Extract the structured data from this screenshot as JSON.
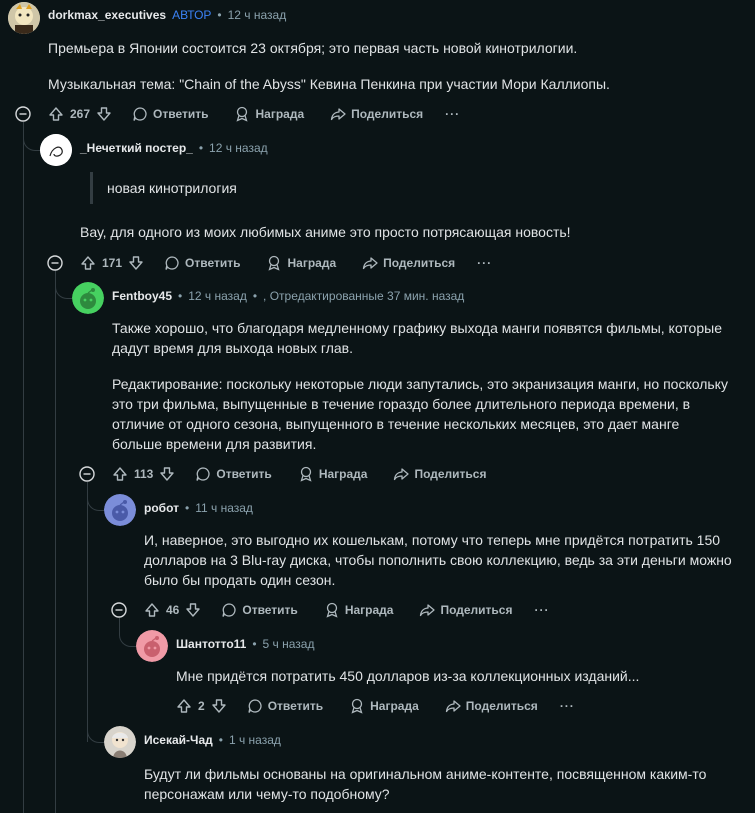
{
  "comments": [
    {
      "username": "dorkmax_executives",
      "author_badge": "АВТОР",
      "time": "12 ч назад",
      "paragraphs": [
        "Премьера в Японии состоится 23 октября; это первая часть новой кинотрилогии.",
        "Музыкальная тема: \"Chain of the Abyss\" Кевина Пенкина при участии Мори Каллиопы."
      ],
      "votes": "267"
    },
    {
      "username": "_Нечеткий постер_",
      "time": "12 ч назад",
      "quote": "новая кинотрилогия",
      "paragraphs": [
        "Вау, для одного из моих любимых аниме это просто потрясающая новость!"
      ],
      "votes": "171"
    },
    {
      "username": "Fentboy45",
      "time": "12 ч назад",
      "edited": ", Отредактированные 37 мин. назад",
      "paragraphs": [
        "Также хорошо, что благодаря медленному графику выхода манги появятся фильмы, которые дадут время для выхода новых глав.",
        "Редактирование: поскольку некоторые люди запутались, это экранизация манги, но поскольку это три фильма, выпущенные в течение гораздо более длительного периода времени, в отличие от одного сезона, выпущенного в течение нескольких месяцев, это дает манге больше времени для развития."
      ],
      "votes": "113"
    },
    {
      "username": "робот",
      "time": "11 ч назад",
      "paragraphs": [
        "И, наверное, это выгодно их кошелькам, потому что теперь мне придётся потратить 150 долларов на 3 Blu-ray диска, чтобы пополнить свою коллекцию, ведь за эти деньги можно было бы продать один сезон."
      ],
      "votes": "46"
    },
    {
      "username": "Шантотто11",
      "time": "5 ч назад",
      "paragraphs": [
        "Мне придётся потратить 450 долларов из-за коллекционных изданий..."
      ],
      "votes": "2"
    },
    {
      "username": "Исекай-Чад",
      "time": "1 ч назад",
      "paragraphs": [
        "Будут ли фильмы основаны на оригинальном аниме-контенте, посвященном каким-то персонажам или чему-то подобному?"
      ]
    }
  ],
  "actions": {
    "reply": "Ответить",
    "award": "Награда",
    "share": "Поделиться",
    "more": "···"
  },
  "icons": [
    "upvote-icon",
    "downvote-icon",
    "comment-icon",
    "award-icon",
    "share-icon",
    "collapse-icon",
    "more-icon"
  ],
  "colors": {
    "background": "#0b1416",
    "author_badge": "#3b82f6",
    "thread_line": "#333d42"
  }
}
